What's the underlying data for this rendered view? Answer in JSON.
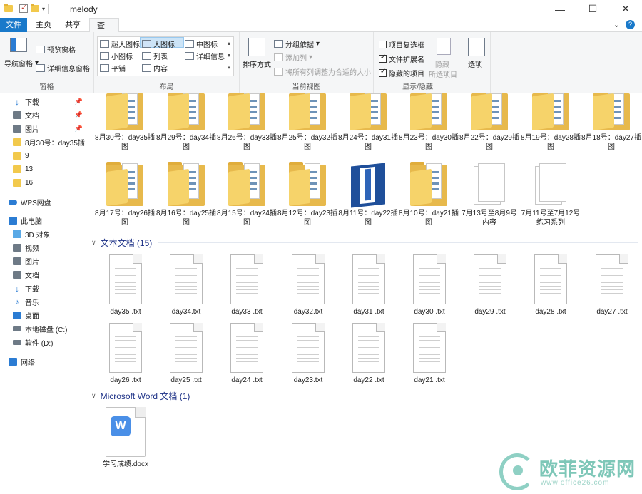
{
  "window": {
    "title": "melody",
    "minimize": "—",
    "maximize": "☐",
    "close": "✕"
  },
  "tabs": {
    "file": "文件",
    "home": "主页",
    "share": "共享",
    "view": "查看",
    "collapse": "⌄"
  },
  "ribbon": {
    "pane": {
      "nav_pane": "导航窗格",
      "preview_pane": "预览窗格",
      "details_pane": "详细信息窗格",
      "label": "窗格"
    },
    "layout": {
      "extra_large": "超大图标",
      "large": "大图标",
      "medium": "中图标",
      "small": "小图标",
      "list": "列表",
      "details": "详细信息",
      "tiles": "平铺",
      "content": "内容",
      "label": "布局"
    },
    "current_view": {
      "sort_by": "排序方式",
      "group_by": "分组依据",
      "add_columns": "添加列",
      "size_all_columns": "将所有列调整为合适的大小",
      "label": "当前视图"
    },
    "show_hide": {
      "item_checkboxes": "项目复选框",
      "file_extensions": "文件扩展名",
      "hidden_items": "隐藏的项目",
      "hide_selected": "隐藏",
      "hide_selected2": "所选项目",
      "label": "显示/隐藏",
      "item_checkboxes_on": false,
      "file_extensions_on": true,
      "hidden_items_on": true
    },
    "options": {
      "label": "选项"
    }
  },
  "nav": {
    "items": [
      {
        "label": "下载",
        "icon": "download-icon",
        "pinned": true
      },
      {
        "label": "文档",
        "icon": "documents-icon",
        "pinned": true
      },
      {
        "label": "图片",
        "icon": "pictures-icon",
        "pinned": true
      },
      {
        "label": "8月30号：day35插",
        "icon": "folder-icon",
        "pinned": false
      },
      {
        "label": "9",
        "icon": "folder-icon",
        "pinned": false
      },
      {
        "label": "13",
        "icon": "folder-icon",
        "pinned": false
      },
      {
        "label": "16",
        "icon": "folder-icon",
        "pinned": false
      },
      {
        "label": "WPS网盘",
        "icon": "cloud-icon",
        "pinned": false
      },
      {
        "label": "此电脑",
        "icon": "computer-icon",
        "pinned": false
      },
      {
        "label": "3D 对象",
        "icon": "3d-objects-icon",
        "pinned": false
      },
      {
        "label": "视频",
        "icon": "video-icon",
        "pinned": false
      },
      {
        "label": "图片",
        "icon": "pictures-icon",
        "pinned": false
      },
      {
        "label": "文档",
        "icon": "documents-icon",
        "pinned": false
      },
      {
        "label": "下载",
        "icon": "download-icon",
        "pinned": false
      },
      {
        "label": "音乐",
        "icon": "music-icon",
        "pinned": false
      },
      {
        "label": "桌面",
        "icon": "desktop-icon",
        "pinned": false
      },
      {
        "label": "本地磁盘 (C:)",
        "icon": "drive-icon",
        "pinned": false
      },
      {
        "label": "软件 (D:)",
        "icon": "drive-icon",
        "pinned": false
      },
      {
        "label": "网络",
        "icon": "network-icon",
        "pinned": false
      }
    ]
  },
  "folders_row1": [
    "8月30号：day35插图",
    "8月29号：day34插图",
    "8月26号：day33插图",
    "8月25号：day32插图",
    "8月24号：day31插图",
    "8月23号：day30插图",
    "8月22号：day29插图",
    "8月19号：day28插图",
    "8月18号：day27插图"
  ],
  "folders_row2": [
    "8月17号：day26插图",
    "8月16号：day25插图",
    "8月15号：day24插图",
    "8月12号：day23插图",
    "8月11号：day22插图",
    "8月10号：day21插图",
    "7月13号至8月9号 内容",
    "7月11号至7月12号练习系列"
  ],
  "sections": {
    "text_docs": "文本文档 (15)",
    "word_docs": "Microsoft Word 文档 (1)"
  },
  "txt_row1": [
    "day35 .txt",
    "day34.txt",
    "day33 .txt",
    "day32.txt",
    "day31 .txt",
    "day30 .txt",
    "day29 .txt",
    "day28 .txt",
    "day27 .txt"
  ],
  "txt_row2": [
    "day26 .txt",
    "day25 .txt",
    "day24 .txt",
    "day23.txt",
    "day22 .txt",
    "day21 .txt"
  ],
  "word_files": [
    "学习成绩.docx"
  ],
  "watermark": {
    "brand": "欧菲资源网",
    "url": "www.office26.com"
  }
}
